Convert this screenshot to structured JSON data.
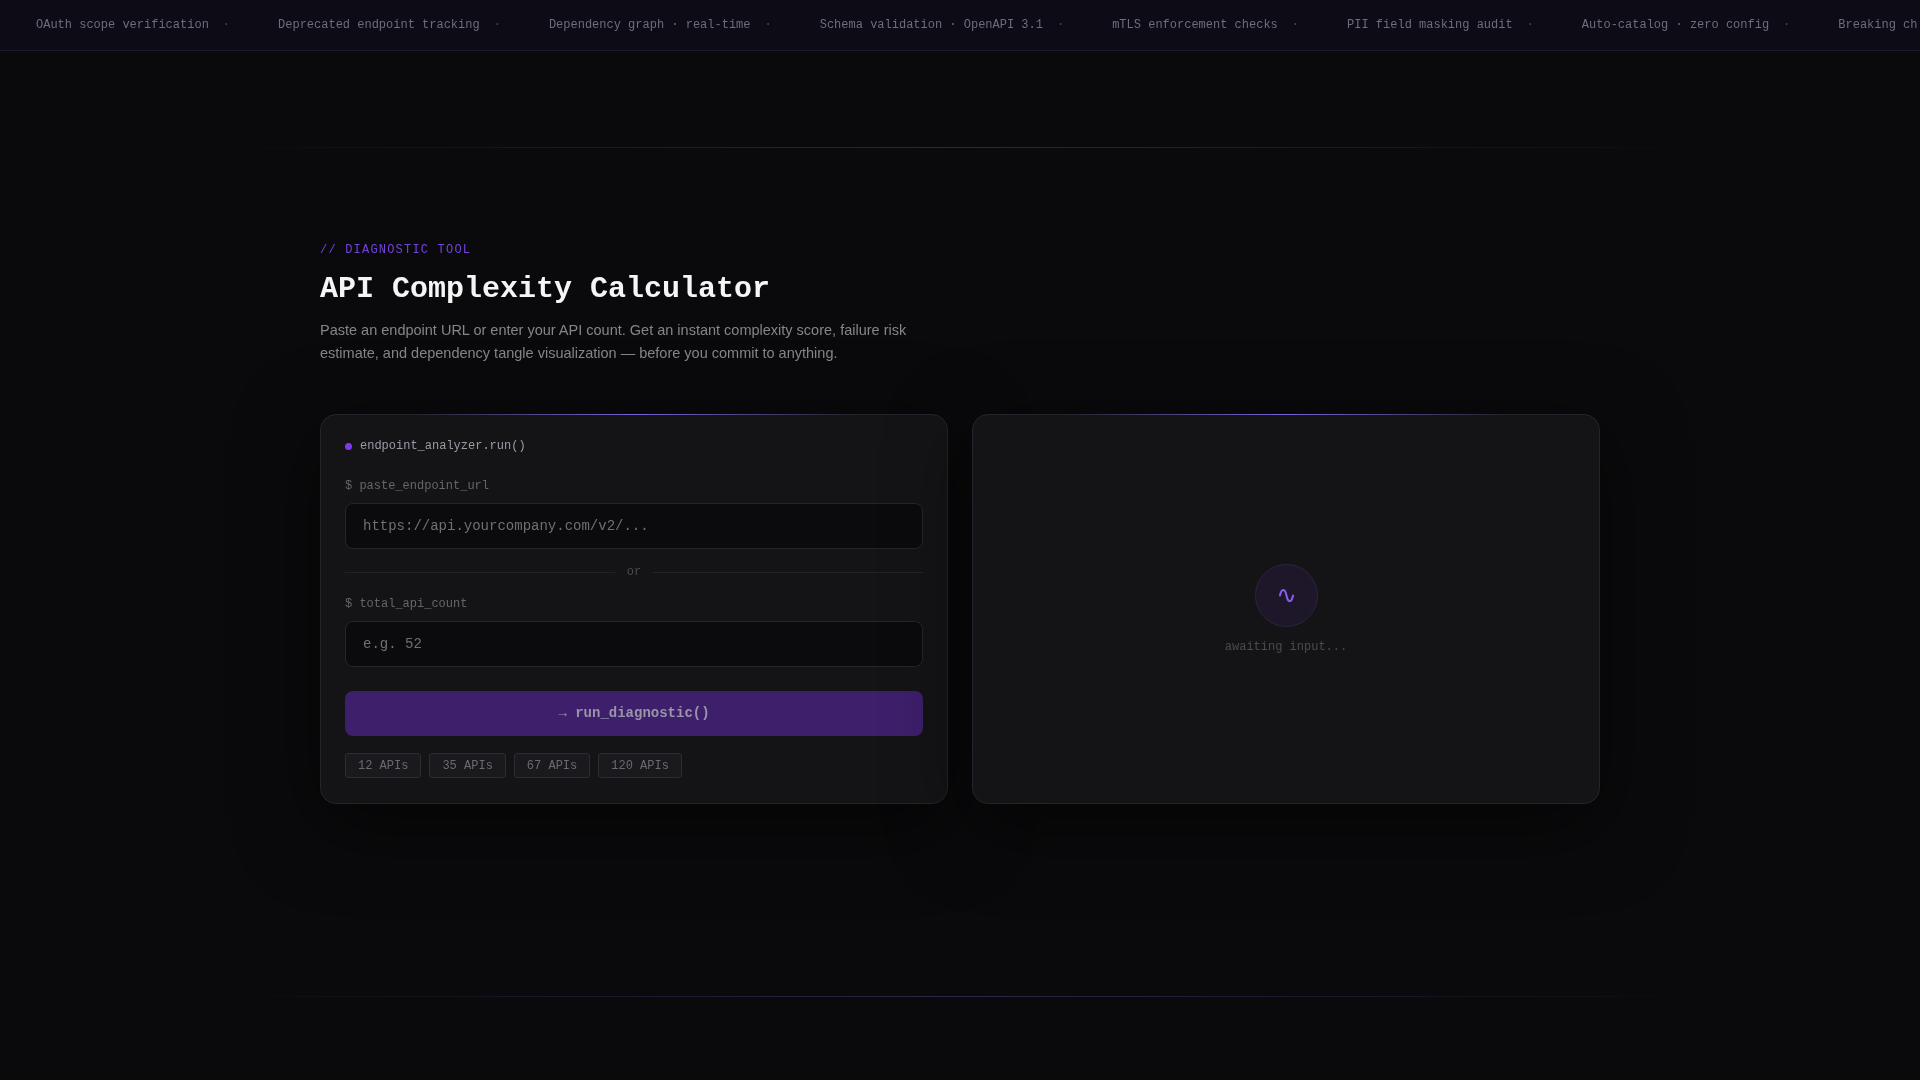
{
  "ticker": {
    "items": [
      {
        "text": "OAuth scope verification",
        "separator": "·"
      },
      {
        "text": "Deprecated endpoint tracking",
        "separator": "·"
      },
      {
        "text": "Dependency graph · real-time",
        "separator": "·"
      },
      {
        "text": "Schema validation · OpenAPI 3.1",
        "separator": "·"
      },
      {
        "text": "mTLS enforcement checks",
        "separator": "·"
      },
      {
        "text": "PII field masking audit",
        "separator": "·"
      },
      {
        "text": "Auto-catalog · zero config",
        "separator": "·"
      },
      {
        "text": "Breaking ch"
      }
    ]
  },
  "hero": {
    "eyebrow": "// DIAGNOSTIC TOOL",
    "title": "API Complexity Calculator",
    "description": "Paste an endpoint URL or enter your API count. Get an instant complexity score, failure risk estimate, and dependency tangle visualization — before you commit to anything."
  },
  "analyzer": {
    "header": "endpoint_analyzer.run()",
    "url_field": {
      "label": "$ paste_endpoint_url",
      "placeholder": "https://api.yourcompany.com/v2/..."
    },
    "divider": "or",
    "count_field": {
      "label": "$ total_api_count",
      "placeholder": "e.g. 52"
    },
    "run_button": {
      "label": "→ run_diagnostic()",
      "disabled": true
    },
    "presets": [
      "12 APIs",
      "35 APIs",
      "67 APIs",
      "120 APIs"
    ]
  },
  "result_panel": {
    "status": "awaiting input..."
  }
}
